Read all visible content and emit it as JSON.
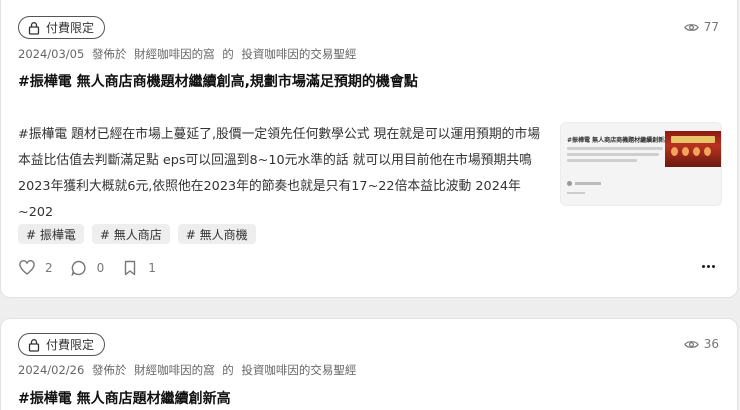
{
  "posts": [
    {
      "badge": "付費限定",
      "views": "77",
      "date": "2024/03/05",
      "published_in": "發佈於",
      "space": "財經咖啡因的窩",
      "of": "的",
      "category": "投資咖啡因的交易聖經",
      "title": "#振樺電 無人商店商機題材繼續創高,規劃市場滿足預期的機會點",
      "excerpt": "#振樺電 題材已經在市場上蔓延了,股價一定領先任何數學公式 現在就是可以運用預期的市場本益比估值去判斷滿足點 eps可以回溫到8~10元水準的話 就可以用目前他在市場預期共鳴 2023年獲利大概就6元,依照他在2023年的節奏也就是只有17~22倍本益比波動 2024年~202",
      "thumbnail": {
        "title": "#振樺電 無人商店商機題材繼續創新高"
      },
      "tags": [
        "# 振樺電",
        "# 無人商店",
        "# 無人商機"
      ],
      "likes": "2",
      "comments": "0",
      "bookmarks": "1"
    },
    {
      "badge": "付費限定",
      "views": "36",
      "date": "2024/02/26",
      "published_in": "發佈於",
      "space": "財經咖啡因的窩",
      "of": "的",
      "category": "投資咖啡因的交易聖經",
      "title": "#振樺電 無人商店題材繼續創新高"
    }
  ],
  "icons": {
    "lock": "lock-icon",
    "eye": "eye-icon",
    "heart": "heart-icon",
    "comment": "comment-icon",
    "bookmark": "bookmark-icon",
    "more": "more-icon"
  }
}
